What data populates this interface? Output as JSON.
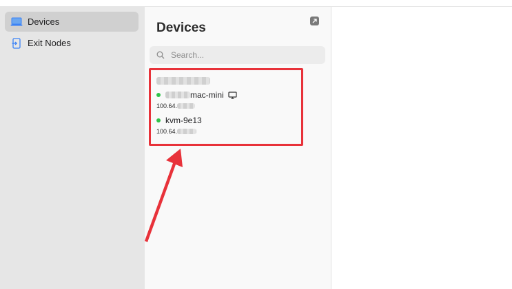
{
  "sidebar": {
    "items": [
      {
        "label": "Devices",
        "icon": "laptop-icon",
        "active": true
      },
      {
        "label": "Exit Nodes",
        "icon": "exit-node-icon",
        "active": false
      }
    ]
  },
  "panel": {
    "title": "Devices",
    "search": {
      "placeholder": "Search..."
    }
  },
  "devices": [
    {
      "name_suffix": "mac-mini",
      "ip_prefix": "100.64.",
      "status": "online",
      "icon": "desktop-monitor-icon"
    },
    {
      "name_suffix": "kvm-9e13",
      "ip_prefix": "100.64.",
      "status": "online"
    }
  ],
  "colors": {
    "accent": "#3b82f6",
    "online": "#30c24a",
    "annotation": "#e8323a",
    "sidebar_bg": "#e6e6e6",
    "panel_bg": "#f9f9f9"
  }
}
